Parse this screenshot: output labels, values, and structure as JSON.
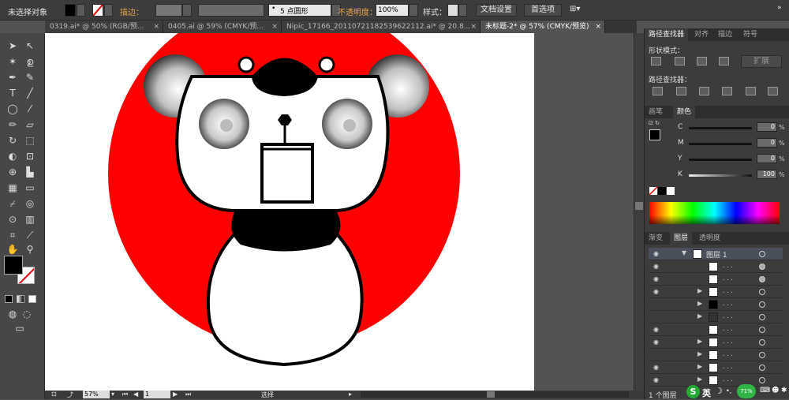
{
  "control_bar": {
    "selection_label": "未选择对象",
    "stroke_label": "描边：",
    "brush_label": "5 点圆形",
    "opacity_label": "不透明度：",
    "opacity_value": "100%",
    "style_label": "样式：",
    "doc_setup": "文档设置",
    "preferences": "首选项"
  },
  "tabs": [
    {
      "label": "0319.ai* @ 50% (RGB/预..."
    },
    {
      "label": "0405.ai @ 59% (CMYK/预..."
    },
    {
      "label": "Nipic_17166_20110721182539622112.ai* @ 20.8..."
    },
    {
      "label": "未标题-2* @ 57% (CMYK/预览)"
    }
  ],
  "status": {
    "zoom": "57%",
    "page": "1",
    "mode": "选择"
  },
  "pathfinder": {
    "tabs": [
      "路径查找器",
      "对齐",
      "描边",
      "符号"
    ],
    "shape_modes_label": "形状模式：",
    "expand_label": "扩展",
    "pathfinders_label": "路径查找器："
  },
  "color_panel": {
    "tabs": [
      "画笔",
      "颜色"
    ],
    "channels": [
      {
        "name": "C",
        "value": "0",
        "unit": "%"
      },
      {
        "name": "M",
        "value": "0",
        "unit": "%"
      },
      {
        "name": "Y",
        "value": "0",
        "unit": "%"
      },
      {
        "name": "K",
        "value": "100",
        "unit": "%"
      }
    ]
  },
  "layers_panel": {
    "tabs": [
      "渐变",
      "图层",
      "透明度"
    ],
    "layer_name": "图层 1",
    "footer": "1 个图层"
  },
  "tray": {
    "percent": "71%",
    "lang": "英"
  },
  "colors": {
    "red": "#ff0000",
    "black": "#000000",
    "ui_dark": "#3c3c3c"
  }
}
